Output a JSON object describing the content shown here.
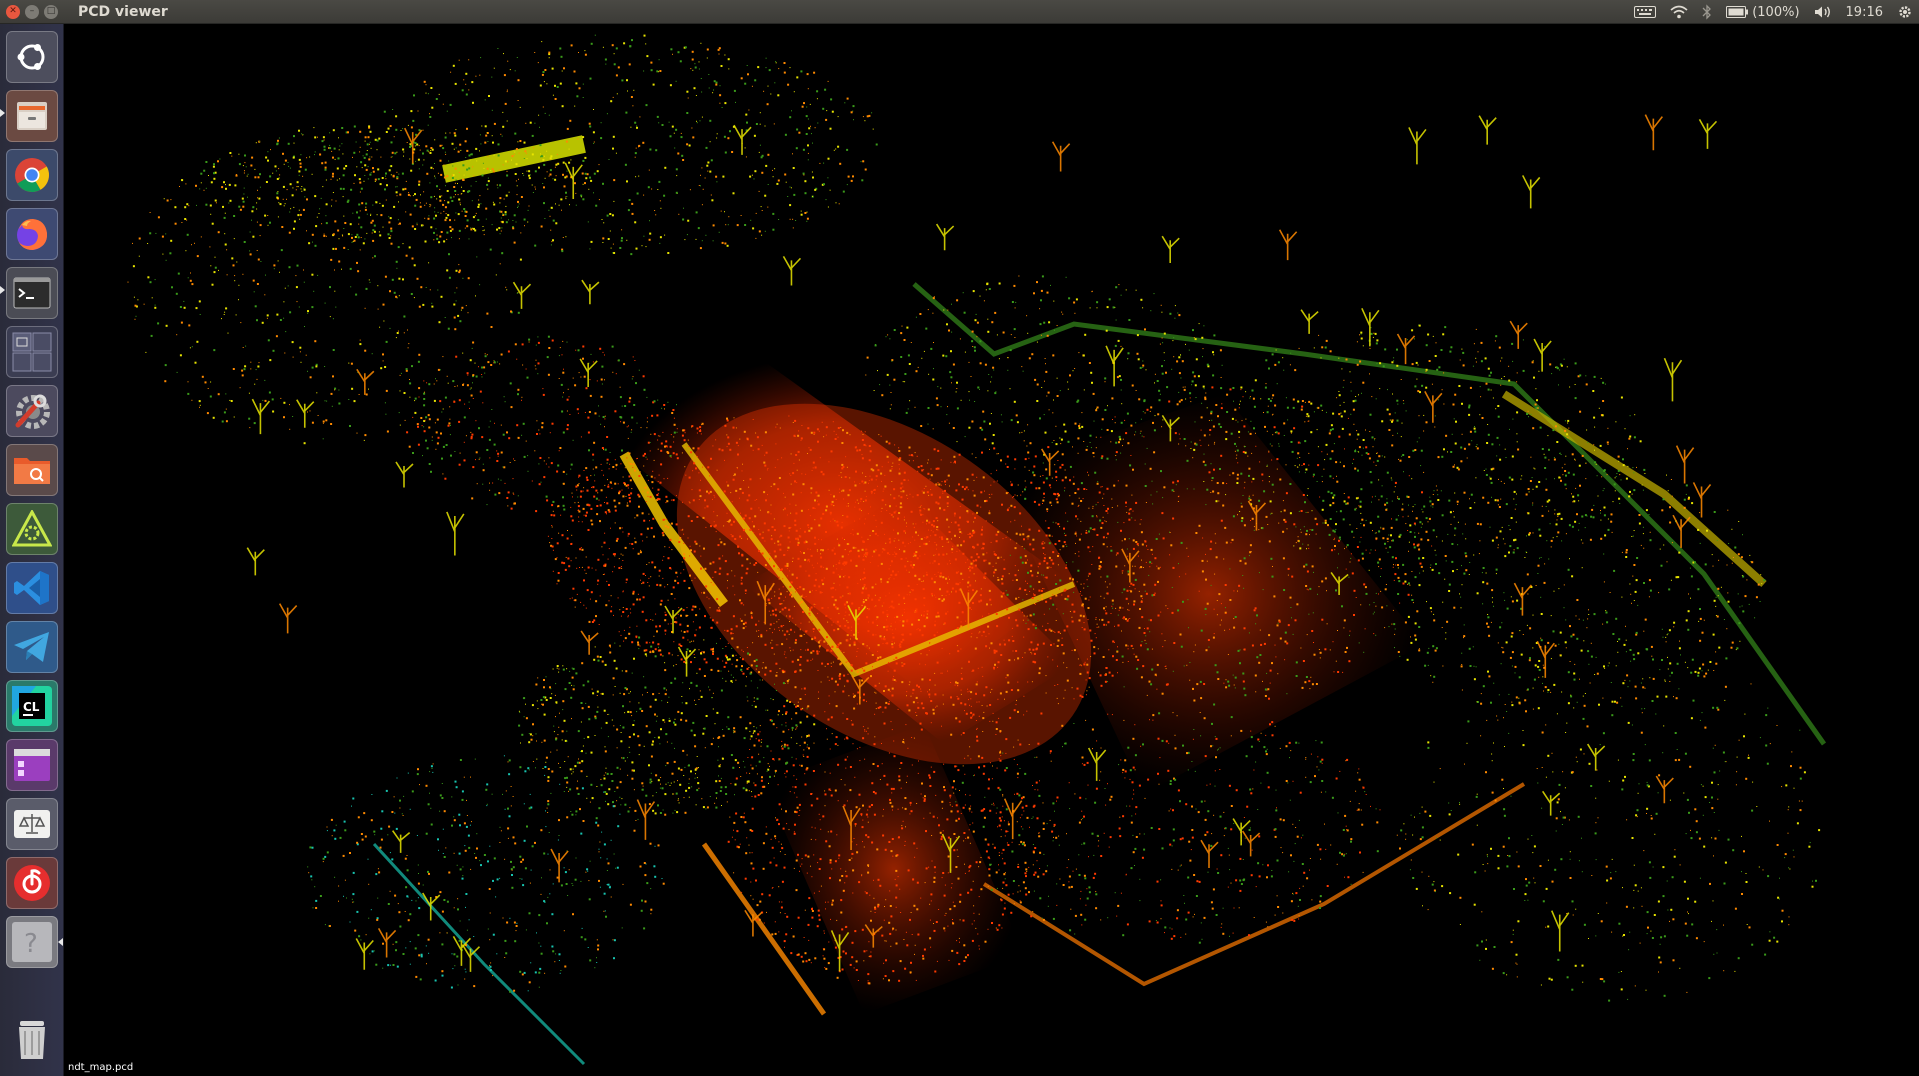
{
  "window": {
    "title": "PCD viewer"
  },
  "indicators": {
    "battery": "(100%)",
    "time": "19:16",
    "icons": [
      "keyboard-icon",
      "wifi-icon",
      "bluetooth-icon",
      "battery-icon",
      "volume-icon",
      "gear-icon"
    ]
  },
  "launcher": {
    "items": [
      {
        "name": "ubuntu-dash",
        "icon": "ubuntu-logo-icon"
      },
      {
        "name": "files",
        "icon": "file-cabinet-icon"
      },
      {
        "name": "chrome",
        "icon": "chrome-icon"
      },
      {
        "name": "firefox",
        "icon": "firefox-icon"
      },
      {
        "name": "terminal",
        "icon": "terminal-icon"
      },
      {
        "name": "workspace-switcher",
        "icon": "workspaces-icon"
      },
      {
        "name": "system-settings",
        "icon": "settings-wrench-icon"
      },
      {
        "name": "file-manager",
        "icon": "folder-icon"
      },
      {
        "name": "app-triangle",
        "icon": "triangle-gear-icon"
      },
      {
        "name": "vscode",
        "icon": "vscode-icon"
      },
      {
        "name": "telegram",
        "icon": "telegram-icon"
      },
      {
        "name": "clion",
        "icon": "clion-icon",
        "text": "CL"
      },
      {
        "name": "app-purple",
        "icon": "purple-window-icon"
      },
      {
        "name": "app-scale",
        "icon": "scale-icon"
      },
      {
        "name": "netease-music",
        "icon": "music-icon"
      },
      {
        "name": "help",
        "icon": "help-icon",
        "text": "?"
      },
      {
        "name": "trash",
        "icon": "trash-icon"
      }
    ]
  },
  "viewer": {
    "caption": "ndt_map.pcd"
  },
  "colors": {
    "ground": "#ff3a00",
    "mid": "#ff8a00",
    "high": "#e8e400",
    "green": "#3a9a1a",
    "cyan": "#18c4b0"
  }
}
